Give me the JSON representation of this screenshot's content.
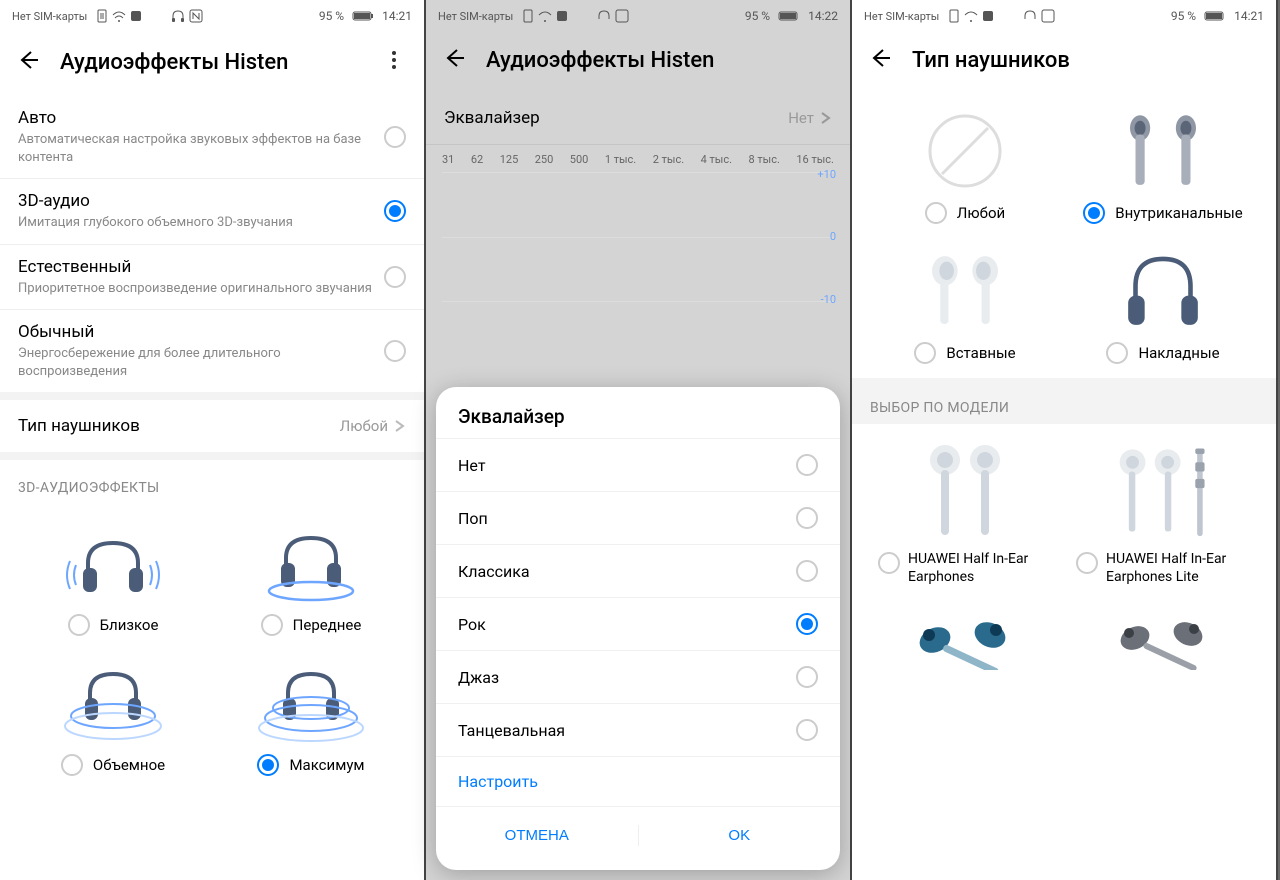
{
  "statusbar": {
    "sim": "Нет SIM-карты",
    "nfc": "N",
    "battery": "95 %",
    "time1": "14:21",
    "time2": "14:22",
    "time3": "14:21"
  },
  "screen1": {
    "title": "Аудиоэффекты Histen",
    "modes": [
      {
        "title": "Авто",
        "sub": "Автоматическая настройка звуковых эффектов на базе контента",
        "selected": false
      },
      {
        "title": "3D-аудио",
        "sub": "Имитация глубокого объемного 3D-звучания",
        "selected": true
      },
      {
        "title": "Естественный",
        "sub": "Приоритетное воспроизведение оригинального звучания",
        "selected": false
      },
      {
        "title": "Обычный",
        "sub": "Энергосбережение для более длительного воспроизведения",
        "selected": false
      }
    ],
    "headphoneTypeLabel": "Тип наушников",
    "headphoneTypeValue": "Любой",
    "sectionLabel": "3D-АУДИОЭФФЕКТЫ",
    "effects": [
      {
        "label": "Близкое",
        "selected": false
      },
      {
        "label": "Переднее",
        "selected": false
      },
      {
        "label": "Объемное",
        "selected": false
      },
      {
        "label": "Максимум",
        "selected": true
      }
    ]
  },
  "screen2": {
    "title": "Аудиоэффекты Histen",
    "eqLabel": "Эквалайзер",
    "eqValue": "Нет",
    "bands": [
      "31",
      "62",
      "125",
      "250",
      "500",
      "1 тыс.",
      "2 тыс.",
      "4 тыс.",
      "8 тыс.",
      "16 тыс."
    ],
    "yLabels": {
      "top": "+10",
      "mid": "0",
      "bot": "-10"
    },
    "dialog": {
      "title": "Эквалайзер",
      "options": [
        {
          "label": "Нет",
          "selected": false
        },
        {
          "label": "Поп",
          "selected": false
        },
        {
          "label": "Классика",
          "selected": false
        },
        {
          "label": "Рок",
          "selected": true
        },
        {
          "label": "Джаз",
          "selected": false
        },
        {
          "label": "Танцевальная",
          "selected": false
        }
      ],
      "tune": "Настроить",
      "cancel": "ОТМЕНА",
      "ok": "OK"
    }
  },
  "screen3": {
    "title": "Тип наушников",
    "types": [
      {
        "label": "Любой",
        "selected": false
      },
      {
        "label": "Внутриканальные",
        "selected": true
      },
      {
        "label": "Вставные",
        "selected": false
      },
      {
        "label": "Накладные",
        "selected": false
      }
    ],
    "modelSectionLabel": "ВЫБОР ПО МОДЕЛИ",
    "models": [
      {
        "label": "HUAWEI Half In-Ear Earphones"
      },
      {
        "label": "HUAWEI Half In-Ear Earphones Lite"
      }
    ]
  }
}
